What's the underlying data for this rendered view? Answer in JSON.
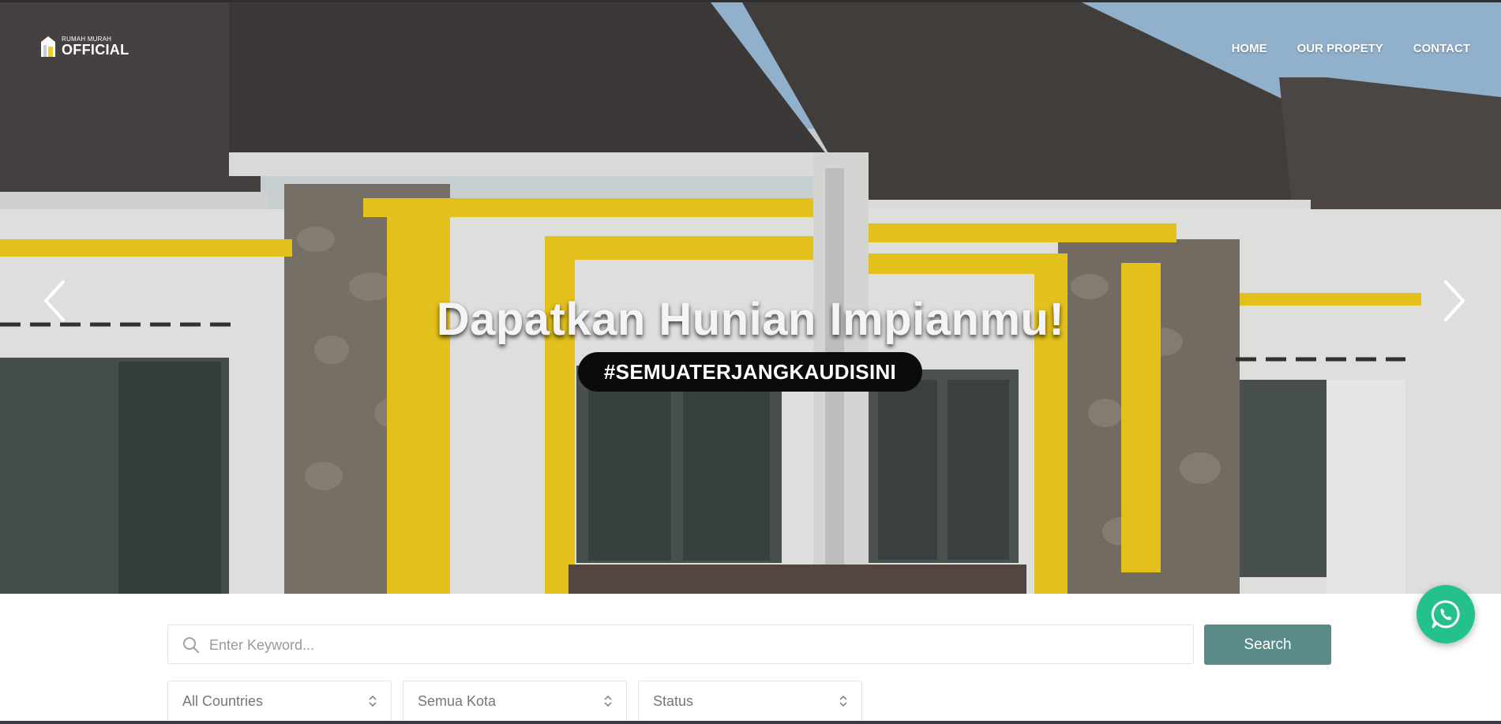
{
  "brand": {
    "logo_small": "RUMAH MURAH",
    "logo_big": "OFFICIAL"
  },
  "nav": {
    "items": [
      {
        "label": "HOME"
      },
      {
        "label": "OUR PROPETY"
      },
      {
        "label": "CONTACT"
      }
    ]
  },
  "hero": {
    "title": "Dapatkan Hunian Impianmu!",
    "tagline": "#SEMUATERJANGKAUDISINI"
  },
  "search": {
    "placeholder": "Enter Keyword...",
    "value": "",
    "button_label": "Search"
  },
  "filters": [
    {
      "label": "All Countries"
    },
    {
      "label": "Semua Kota"
    },
    {
      "label": "Status"
    }
  ],
  "colors": {
    "search_button": "#5a8b88",
    "whatsapp": "#25c18b",
    "accent_yellow": "#f2cc1e"
  },
  "icons": {
    "prev": "chevron-left-icon",
    "next": "chevron-right-icon",
    "search": "search-icon",
    "whatsapp": "whatsapp-icon",
    "select": "select-chevrons-icon"
  }
}
